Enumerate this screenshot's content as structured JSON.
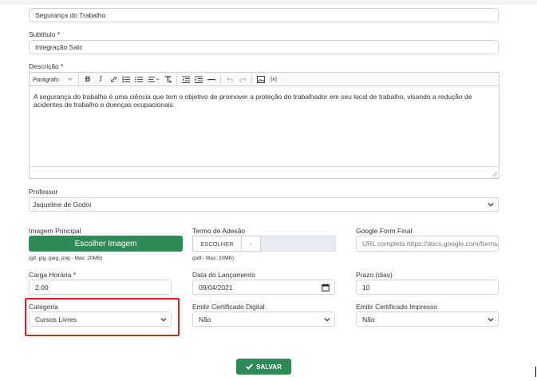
{
  "form": {
    "title_value": "Segurança do Trabalho",
    "subtitle_label": "Subtítulo *",
    "subtitle_value": "Integração Satc",
    "description_label": "Descrição *",
    "editor": {
      "paragraph_select": "Parágrafo",
      "toolbar_icons": [
        "bold-icon",
        "italic-icon",
        "link-icon",
        "bullet-list-icon",
        "numbered-list-icon",
        "align-icon",
        "clear-format-icon",
        "indent-icon",
        "outdent-icon",
        "horizontal-rule-icon",
        "undo-icon",
        "redo-icon",
        "image-icon",
        "variable-icon"
      ],
      "content": "A segurança do trabalho é uma ciência que tem o objetivo de promover a proteção do trabalhador em seu local de trabalho, visando a redução de acidentes de trabalho e doenças ocupacionais."
    },
    "professor_label": "Professor",
    "professor_value": "Jaqueline de Godoi",
    "image_label": "Imagem Principal",
    "image_button": "Escolher Imagem",
    "image_help": "(gif, jpg, jpeg, png - Max: 20MB)",
    "term_label": "Termo de Adesão",
    "term_button": "ESCOLHER",
    "term_dropdown": "-",
    "term_help": "(pdf - Max: 20MB)",
    "google_form_label": "Google Form Final",
    "google_form_placeholder": "URL completa https://docs.google.com/forms/c",
    "workload_label": "Carga Horária *",
    "workload_value": "2,00",
    "launch_label": "Data do Lançamento",
    "launch_value": "09/04/2021",
    "deadline_label": "Prazo (dias)",
    "deadline_value": "10",
    "category_label": "Categoria",
    "category_value": "Cursos Livres",
    "digital_cert_label": "Emitir Certificado Digital",
    "digital_cert_value": "Não",
    "printed_cert_label": "Emitir Certificado Impresso",
    "printed_cert_value": "Não",
    "save_button": "SALVAR"
  },
  "colors": {
    "accent_green": "#2e8b57",
    "highlight_red": "#e02020"
  }
}
